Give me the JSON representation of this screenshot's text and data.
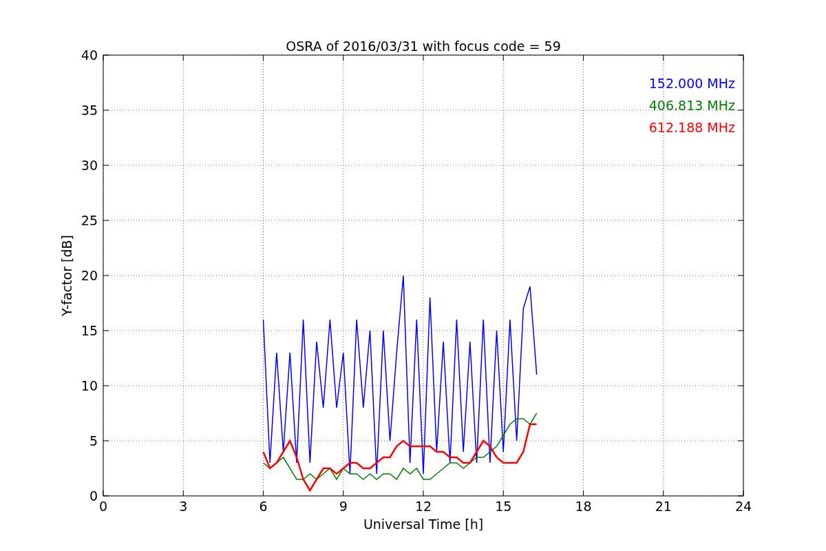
{
  "figure": {
    "chart_data": {
      "type": "line",
      "title": "OSRA of 2016/03/31 with focus code = 59",
      "xlabel": "Universal Time [h]",
      "ylabel": "Y-factor [dB]",
      "x": [
        6.0,
        6.25,
        6.5,
        6.75,
        7.0,
        7.25,
        7.5,
        7.75,
        8.0,
        8.25,
        8.5,
        8.75,
        9.0,
        9.25,
        9.5,
        9.75,
        10.0,
        10.25,
        10.5,
        10.75,
        11.0,
        11.25,
        11.5,
        11.75,
        12.0,
        12.25,
        12.5,
        12.75,
        13.0,
        13.25,
        13.5,
        13.75,
        14.0,
        14.25,
        14.5,
        14.75,
        15.0,
        15.25,
        15.5,
        15.75,
        16.0,
        16.25
      ],
      "series": [
        {
          "name": "152.000 MHz",
          "color": "#0000ff",
          "values": [
            16,
            3,
            13,
            4,
            13,
            3,
            16,
            3,
            14,
            8,
            16,
            8,
            13,
            2,
            16,
            8,
            15,
            2,
            15,
            5,
            13,
            20,
            3,
            16,
            2,
            18,
            4,
            14,
            3,
            16,
            4,
            14,
            3,
            16,
            3,
            15,
            4,
            16,
            5,
            17,
            19,
            11
          ]
        },
        {
          "name": "406.813 MHz",
          "color": "#008000",
          "values": [
            3,
            2.5,
            3,
            3.5,
            2.5,
            1.5,
            1.5,
            2,
            1.5,
            2,
            2.5,
            1.5,
            2.5,
            2,
            2,
            1.5,
            2,
            1.5,
            2,
            2,
            1.5,
            2.5,
            2,
            2.5,
            1.5,
            1.5,
            2,
            2.5,
            3,
            3,
            2.5,
            3,
            3.5,
            3.5,
            4,
            4.5,
            5.5,
            6.5,
            7,
            7,
            6.5,
            7.5
          ]
        },
        {
          "name": "612.188 MHz",
          "color": "#ff0000",
          "values": [
            4,
            2.5,
            3,
            4,
            5,
            3.5,
            1.5,
            0.5,
            1.5,
            2.5,
            2.5,
            2,
            2.5,
            3,
            3,
            2.5,
            2.5,
            3,
            3.5,
            3.5,
            4.5,
            5,
            4.5,
            4.5,
            4.5,
            4.5,
            4,
            4,
            3.5,
            3.5,
            3,
            3,
            4,
            5,
            4.5,
            3.5,
            3,
            3,
            3,
            4,
            6.5,
            6.5
          ]
        }
      ],
      "grid": true,
      "xlim": [
        0,
        24
      ],
      "ylim": [
        0,
        40
      ],
      "xticks": [
        0,
        3,
        6,
        9,
        12,
        15,
        18,
        21,
        24
      ],
      "yticks": [
        0,
        5,
        10,
        15,
        20,
        25,
        30,
        35,
        40
      ]
    }
  }
}
